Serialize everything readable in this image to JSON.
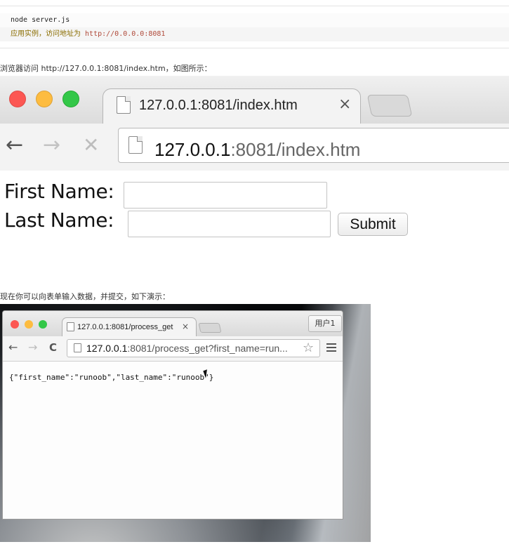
{
  "code_block": {
    "line1": "node server.js",
    "line2_prefix": "应用实例，访问地址为 ",
    "line2_url": "http://0.0.0.0:8081"
  },
  "para1": "浏览器访问 http://127.0.0.1:8081/index.htm，如图所示：",
  "para2": "现在你可以向表单输入数据，并提交，如下演示：",
  "browser1": {
    "tab_title": "127.0.0.1:8081/index.htm",
    "tab_close": "×",
    "url_host": "127.0.0.1",
    "url_rest": ":8081/index.htm",
    "back_icon": "←",
    "forward_icon": "→",
    "stop_icon": "✕",
    "traffic_lights": {
      "close": "#fc5753",
      "minimize": "#fdbc40",
      "zoom": "#33c748"
    }
  },
  "form": {
    "first_name_label": "First Name:",
    "last_name_label": "Last Name:",
    "first_name_value": "",
    "last_name_value": "",
    "submit_label": "Submit"
  },
  "browser2": {
    "tab_title": "127.0.0.1:8081/process_get",
    "tab_close": "×",
    "user_button": "用户1",
    "url_host": "127.0.0.1",
    "url_rest": ":8081/process_get?first_name=run...",
    "back_icon": "←",
    "forward_icon": "→",
    "reload_icon": "C",
    "star_icon": "☆",
    "json_output": "{\"first_name\":\"runoob\",\"last_name\":\"runoob\"}"
  }
}
